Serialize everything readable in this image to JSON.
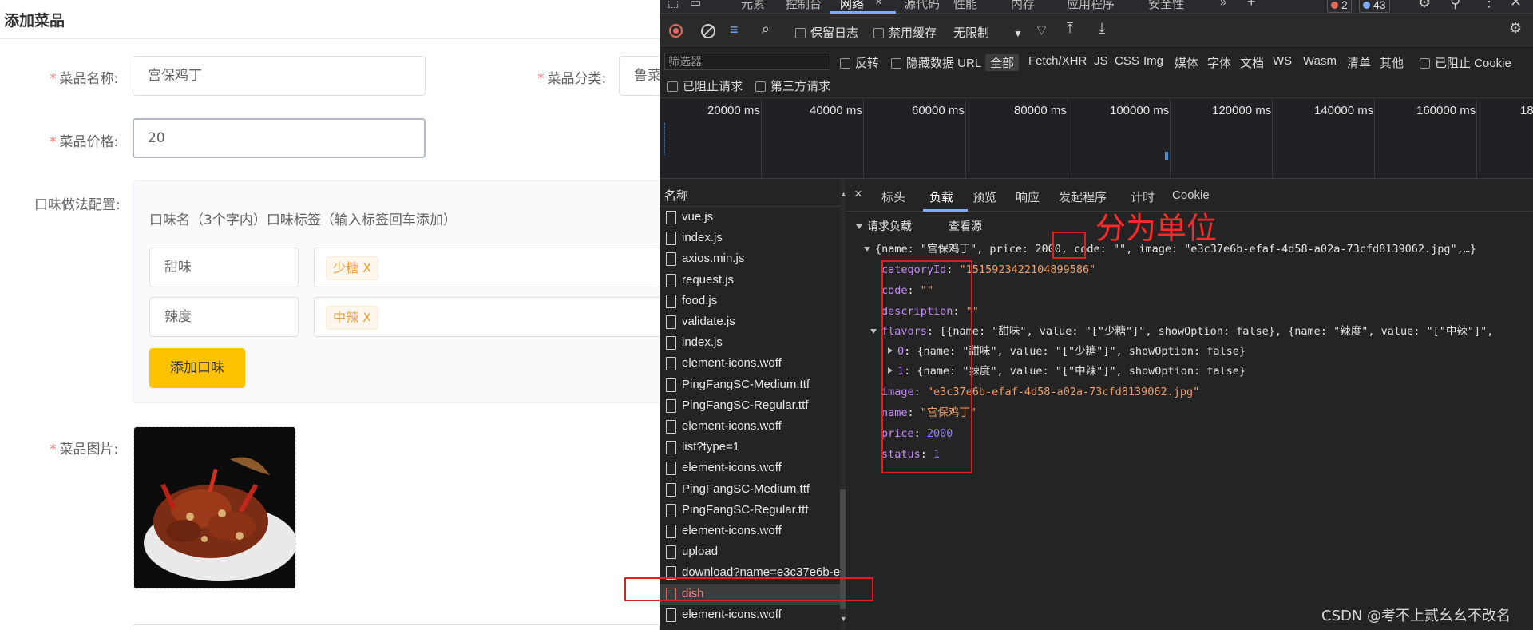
{
  "form": {
    "page_title": "添加菜品",
    "name_label": "菜品名称:",
    "name_value": "宫保鸡丁",
    "category_label": "菜品分类:",
    "category_value": "鲁菜",
    "price_label": "菜品价格:",
    "price_value": "20",
    "flavor_label": "口味做法配置:",
    "flavor_header": "口味名（3个字内）口味标签（输入标签回车添加）",
    "flavors": [
      {
        "name": "甜味",
        "tag": "少糖 X"
      },
      {
        "name": "辣度",
        "tag": "中辣 X"
      }
    ],
    "add_flavor_label": "添加口味",
    "image_label": "菜品图片:"
  },
  "devtools": {
    "tabs": [
      "元素",
      "控制台",
      "网络",
      "源代码",
      "性能",
      "内存",
      "应用程序",
      "安全性"
    ],
    "active_tab": "网络",
    "tab_close": "×",
    "error_count": "2",
    "message_count": "43",
    "toolbar": {
      "preserve_log": "保留日志",
      "disable_cache": "禁用缓存",
      "throttle": "无限制"
    },
    "filter": {
      "placeholder": "筛选器",
      "invert": "反转",
      "hide_data_url": "隐藏数据 URL",
      "all": "全部",
      "types": [
        "Fetch/XHR",
        "JS",
        "CSS",
        "Img",
        "媒体",
        "字体",
        "文档",
        "WS",
        "Wasm",
        "清单",
        "其他"
      ],
      "blocked_cookies": "已阻止 Cookie",
      "blocked_requests": "已阻止请求",
      "third_party": "第三方请求"
    },
    "timeline_labels": [
      "20000 ms",
      "40000 ms",
      "60000 ms",
      "80000 ms",
      "100000 ms",
      "120000 ms",
      "140000 ms",
      "160000 ms",
      "18"
    ],
    "names_header": "名称",
    "files": [
      "vue.js",
      "index.js",
      "axios.min.js",
      "request.js",
      "food.js",
      "validate.js",
      "index.js",
      "element-icons.woff",
      "PingFangSC-Medium.ttf",
      "PingFangSC-Regular.ttf",
      "element-icons.woff",
      "list?type=1",
      "element-icons.woff",
      "PingFangSC-Medium.ttf",
      "PingFangSC-Regular.ttf",
      "element-icons.woff",
      "upload",
      "download?name=e3c37e6b-e",
      "dish",
      "element-icons.woff"
    ],
    "detail_tabs": [
      "标头",
      "负载",
      "预览",
      "响应",
      "发起程序",
      "计时",
      "Cookie"
    ],
    "detail_close": "×",
    "payload_title": "请求负载",
    "view_source": "查看源",
    "summary_prefix": "{name: \"宫保鸡丁\", price: ",
    "summary_price": "2000",
    "summary_suffix": ", code: \"\", image: \"e3c37e6b-efaf-4d58-a02a-73cfd8139062.jpg\",…}",
    "fields": {
      "categoryId_key": "categoryId",
      "categoryId_val": "\"1515923422104899586\"",
      "code_key": "code",
      "code_val": "\"\"",
      "description_key": "description",
      "description_val": "\"\"",
      "flavors_key": "flavors",
      "flavors_val": "[{name: \"甜味\", value: \"[\"少糖\"]\", showOption: false}, {name: \"辣度\", value: \"[\"中辣\"]\",",
      "flavor0_idx": "0",
      "flavor0_val": "{name: \"甜味\", value: \"[\"少糖\"]\", showOption: false}",
      "flavor1_idx": "1",
      "flavor1_val": "{name: \"辣度\", value: \"[\"中辣\"]\", showOption: false}",
      "image_key": "image",
      "image_val": "\"e3c37e6b-efaf-4d58-a02a-73cfd8139062.jpg\"",
      "name_key": "name",
      "name_val": "\"宫保鸡丁\"",
      "price_key": "price",
      "price_val": "2000",
      "status_key": "status",
      "status_val": "1"
    }
  },
  "annotation": {
    "text": "分为单位",
    "color": "#e02020"
  },
  "watermark": "CSDN @考不上贰幺幺不改名"
}
